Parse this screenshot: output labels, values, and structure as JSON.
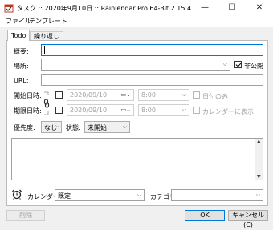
{
  "window": {
    "title": "タスク :: 2020年9月10日 :: Rainlendar Pro 64-Bit 2.15.4",
    "minimize": "—",
    "maximize": "☐",
    "close": "✕"
  },
  "menu": [
    "ファイル",
    "テンプレート"
  ],
  "tabs": [
    "Todo",
    "繰り返し"
  ],
  "form": {
    "summary_label": "概要:",
    "summary_value": "",
    "location_label": "場所:",
    "location_value": "",
    "private_label": "非公開",
    "private_checked": true,
    "url_label": "URL:",
    "url_value": "",
    "start_label": "開始日時:",
    "start_date": "2020/09/10",
    "start_time": "8:00",
    "all_day_label": "日付のみ",
    "due_label": "期限日時:",
    "due_date": "2020/09/10",
    "due_time": "8:00",
    "show_in_calendar_label": "カレンダーに表示",
    "priority_label": "優先度:",
    "priority_value": "なし",
    "status_label": "状態:",
    "status_value": "未開始",
    "notes_value": ""
  },
  "bottom": {
    "calendar_label": "カレンダー:",
    "calendar_value": "既定",
    "category_label": "カテゴリ:",
    "category_value": ""
  },
  "buttons": {
    "delete": "削除",
    "ok": "OK",
    "cancel": "キャンセル(C)"
  },
  "icons": {
    "app": "rainlendar-icon",
    "link": "chain-link-icon",
    "alarm": "alarm-clock-icon"
  }
}
